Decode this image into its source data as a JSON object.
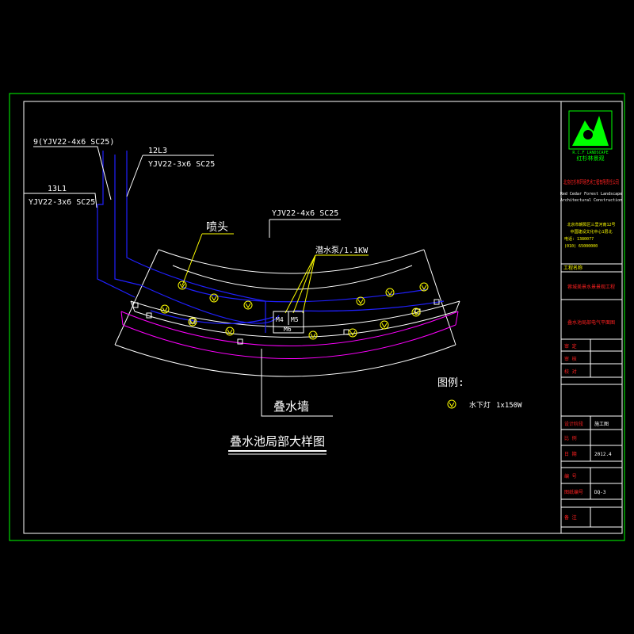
{
  "drawing": {
    "labels": {
      "cable_9": "9(YJV22-4x6 SC25)",
      "cable_12_id": "12L3",
      "cable_12_spec": "YJV22-3x6 SC25",
      "cable_13_id": "13L1",
      "cable_13_spec": "YJV22-3x6 SC25",
      "cable_main": "YJV22-4x6 SC25",
      "nozzle": "喷头",
      "pump": "潜水泵/1.1KW",
      "box_m4": "M4",
      "box_m5": "M5",
      "box_m6": "M6",
      "wall": "叠水墙",
      "title": "叠水池局部大样图"
    },
    "legend": {
      "heading": "图例:",
      "item_label": "水下灯",
      "item_spec": "1x150W"
    }
  },
  "title_block": {
    "company_cn": "北京红杉林环境艺术工程有限责任公司",
    "company_en_1": "Red Cedar Forest Landscape",
    "company_en_2": "Architectural Construction",
    "address_1": "北京市朝阳区三里河南12号",
    "address_2": "中国建设文化中心1层北",
    "tel": "电话: 1380077",
    "fax": "(010) 65000000",
    "logo_text_1": "R.C.F LANDSCAPE",
    "logo_text_2": "红杉林景观",
    "project_header": "工程名称",
    "project_name": "蓉城美景水景景观工程",
    "drawing_name": "叠水池局部电气平面图",
    "rows": [
      {
        "label": "审 定",
        "value": ""
      },
      {
        "label": "审 核",
        "value": ""
      },
      {
        "label": "校 对",
        "value": ""
      },
      {
        "label": "设计阶段",
        "value": "施工图"
      },
      {
        "label": "比 例",
        "value": ""
      },
      {
        "label": "日 期",
        "value": "2012.4"
      },
      {
        "label": "编 号",
        "value": ""
      },
      {
        "label": "图纸编号",
        "value": "DQ-3"
      },
      {
        "label": "备 注",
        "value": ""
      }
    ]
  },
  "colors": {
    "background": "#000000",
    "frame": "#00ff00",
    "line": "#ffffff",
    "cable": "#2020ff",
    "wall_edge": "#ff00ff",
    "leader": "#ffff00",
    "title_red": "#ff2020"
  }
}
